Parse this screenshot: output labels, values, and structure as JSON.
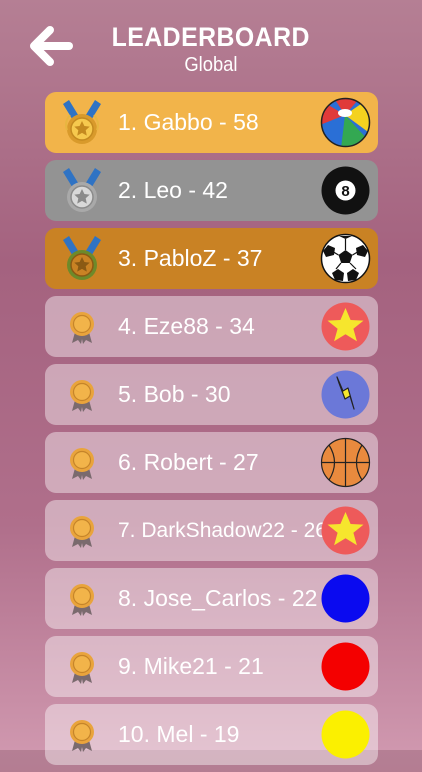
{
  "header": {
    "title": "LEADERBOARD",
    "subtitle": "Global"
  },
  "entries": [
    {
      "label": "1. Gabbo - 58",
      "rank_style": "gold",
      "ball_icon": "beach-ball-icon"
    },
    {
      "label": "2. Leo - 42",
      "rank_style": "silver",
      "ball_icon": "eight-ball-icon"
    },
    {
      "label": "3. PabloZ - 37",
      "rank_style": "bronze",
      "ball_icon": "soccer-ball-icon"
    },
    {
      "label": "4. Eze88 - 34",
      "rank_style": "plain",
      "ball_icon": "star-ball-icon"
    },
    {
      "label": "5. Bob - 30",
      "rank_style": "plain",
      "ball_icon": "lightning-ball-icon"
    },
    {
      "label": "6. Robert - 27",
      "rank_style": "plain",
      "ball_icon": "basketball-icon"
    },
    {
      "label": "7. DarkShadow22 - 26",
      "rank_style": "plain",
      "ball_icon": "star-ball-icon"
    },
    {
      "label": "8. Jose_Carlos - 22",
      "rank_style": "plain",
      "ball_icon": "blue-ball-icon"
    },
    {
      "label": "9. Mike21 - 21",
      "rank_style": "plain",
      "ball_icon": "red-ball-icon"
    },
    {
      "label": "10. Mel - 19",
      "rank_style": "plain",
      "ball_icon": "yellow-ball-icon"
    }
  ],
  "colors": {
    "gold_row": "#f2b44a",
    "silver_row": "#939393",
    "bronze_row": "#c98224",
    "blue_ball": "#0a0af0",
    "red_ball": "#f40000",
    "yellow_ball": "#fbf000",
    "star_ball": "#ee5a5a",
    "lightning_ball": "#6b78d8"
  }
}
